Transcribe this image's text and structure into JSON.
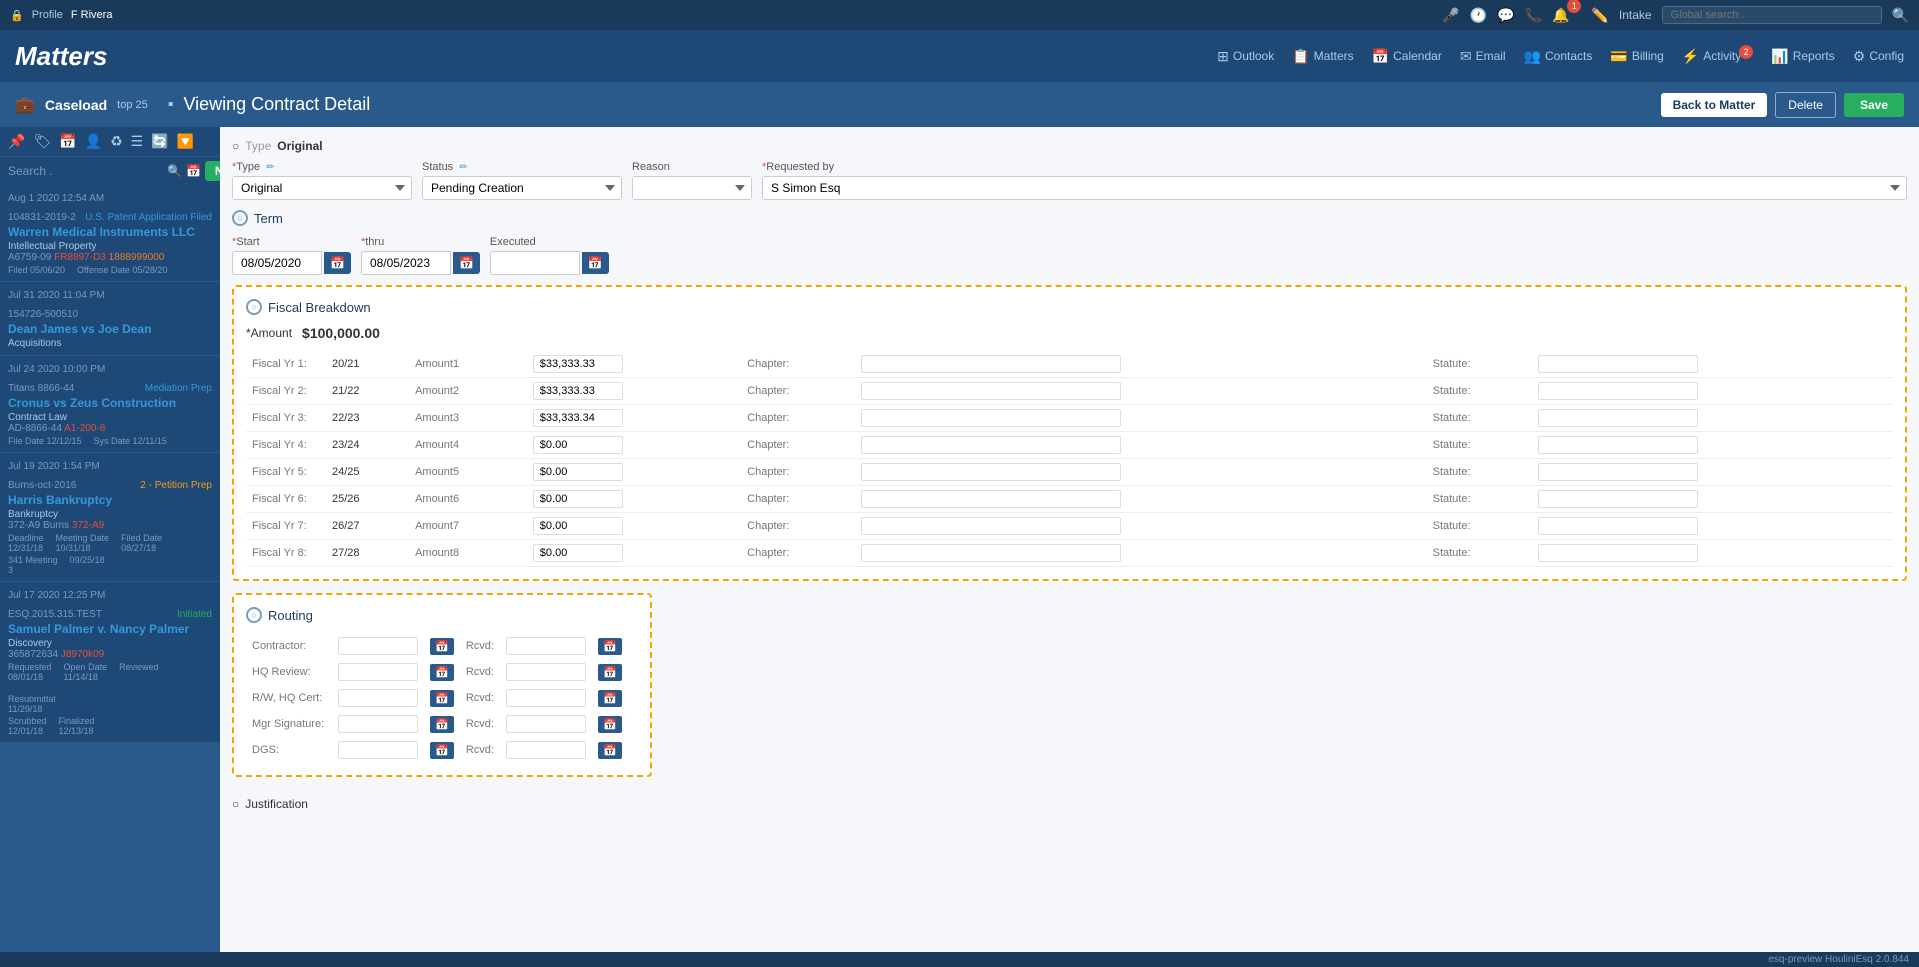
{
  "app": {
    "title": "Matters",
    "user": "F Rivera",
    "profile_label": "Profile"
  },
  "topnav": {
    "global_search_placeholder": "Global search .",
    "icons": [
      "microphone",
      "clock",
      "chat",
      "phone",
      "notification",
      "intake"
    ],
    "intake_label": "Intake",
    "notification_count": "1"
  },
  "appnav": {
    "items": [
      {
        "icon": "⊞",
        "label": "Outlook"
      },
      {
        "icon": "📋",
        "label": "Matters"
      },
      {
        "icon": "📅",
        "label": "Calendar"
      },
      {
        "icon": "✉",
        "label": "Email"
      },
      {
        "icon": "👥",
        "label": "Contacts"
      },
      {
        "icon": "💳",
        "label": "Billing"
      },
      {
        "icon": "⚡",
        "label": "Activity",
        "badge": "2"
      },
      {
        "icon": "📊",
        "label": "Reports"
      },
      {
        "icon": "⚙",
        "label": "Config"
      }
    ]
  },
  "content_header": {
    "caseload_label": "Caseload",
    "top_label": "top 25",
    "title": "Viewing Contract Detail",
    "back_button": "Back to Matter",
    "delete_button": "Delete",
    "save_button": "Save"
  },
  "sidebar": {
    "search_placeholder": "Search .",
    "new_button": "New",
    "items": [
      {
        "date_group": "Aug 1 2020 12:54 AM",
        "id": "104831-2019-2",
        "tag": "U.S. Patent Application Filed",
        "name": "Warren Medical Instruments LLC",
        "type": "Intellectual Property",
        "id2": "A6759-09",
        "id3": "FR8897-D3",
        "id4": "1888999000",
        "filed": "Filed 05/06/20",
        "offense": "Offense Date 05/28/20"
      },
      {
        "date_group": "Jul 31 2020 11:04 PM",
        "id": "154726-500510",
        "tag": "",
        "name": "Dean James vs Joe Dean",
        "type": "Acquisitions"
      },
      {
        "date_group": "Jul 24 2020 10:00 PM",
        "id": "Titans 8866-44",
        "tag": "Mediation Prep",
        "name": "Cronus vs Zeus Construction",
        "type": "Contract Law",
        "id2": "AD-8866-44",
        "id3": "A1-200-8",
        "filed": "File Date 12/12/15",
        "sys": "Sys Date 12/11/15"
      },
      {
        "date_group": "Jul 19 2020 1:54 PM",
        "id": "Burns-oct-2016",
        "tag": "2 - Petition Prep",
        "name": "Harris Bankruptcy",
        "type": "Bankruptcy",
        "id2": "372-A9 Burns",
        "id3": "372-A9",
        "dates": {
          "deadline": "12/31/18",
          "meeting_date": "10/31/18",
          "filed_date": "08/27/18",
          "meetings_341": "341 Meeting",
          "meetings_count": "3",
          "deadline2": "09/25/18"
        }
      },
      {
        "date_group": "Jul 17 2020 12:25 PM",
        "id": "ESQ.2015.315.TEST",
        "tag": "Initiated",
        "name": "Samuel Palmer v. Nancy Palmer",
        "type": "Discovery",
        "id2": "365872634",
        "id3": "J8970k09",
        "dates2": {
          "requested": "08/01/18",
          "open_date": "11/14/18",
          "reviewed": "",
          "resubmittal": "11/29/18",
          "scrubbed": "12/01/18",
          "finalized": "12/13/18"
        }
      }
    ]
  },
  "form": {
    "type_display_label": "Type",
    "type_display_value": "Original",
    "type_label": "Type",
    "type_value": "Original",
    "status_label": "Status",
    "status_value": "Pending Creation",
    "reason_label": "Reason",
    "reason_value": "",
    "requested_by_label": "Requested by",
    "requested_by_value": "S Simon Esq",
    "term_label": "Term",
    "start_label": "Start",
    "start_value": "08/05/2020",
    "thru_label": "thru",
    "thru_value": "08/05/2023",
    "executed_label": "Executed",
    "executed_value": ""
  },
  "fiscal": {
    "section_label": "Fiscal Breakdown",
    "amount_label": "Amount",
    "amount_value": "$100,000.00",
    "rows": [
      {
        "fy": "Fiscal Yr 1:",
        "range": "20/21",
        "amount_label": "Amount1",
        "amount": "$33,333.33",
        "chapter_label": "Chapter:",
        "chapter": "",
        "statute_label": "Statute:",
        "statute": ""
      },
      {
        "fy": "Fiscal Yr 2:",
        "range": "21/22",
        "amount_label": "Amount2",
        "amount": "$33,333.33",
        "chapter_label": "Chapter:",
        "chapter": "",
        "statute_label": "Statute:",
        "statute": ""
      },
      {
        "fy": "Fiscal Yr 3:",
        "range": "22/23",
        "amount_label": "Amount3",
        "amount": "$33,333.34",
        "chapter_label": "Chapter:",
        "chapter": "",
        "statute_label": "Statute:",
        "statute": ""
      },
      {
        "fy": "Fiscal Yr 4:",
        "range": "23/24",
        "amount_label": "Amount4",
        "amount": "$0.00",
        "chapter_label": "Chapter:",
        "chapter": "",
        "statute_label": "Statute:",
        "statute": ""
      },
      {
        "fy": "Fiscal Yr 5:",
        "range": "24/25",
        "amount_label": "Amount5",
        "amount": "$0.00",
        "chapter_label": "Chapter:",
        "chapter": "",
        "statute_label": "Statute:",
        "statute": ""
      },
      {
        "fy": "Fiscal Yr 6:",
        "range": "25/26",
        "amount_label": "Amount6",
        "amount": "$0.00",
        "chapter_label": "Chapter:",
        "chapter": "",
        "statute_label": "Statute:",
        "statute": ""
      },
      {
        "fy": "Fiscal Yr 7:",
        "range": "26/27",
        "amount_label": "Amount7",
        "amount": "$0.00",
        "chapter_label": "Chapter:",
        "chapter": "",
        "statute_label": "Statute:",
        "statute": ""
      },
      {
        "fy": "Fiscal Yr 8:",
        "range": "27/28",
        "amount_label": "Amount8",
        "amount": "$0.00",
        "chapter_label": "Chapter:",
        "chapter": "",
        "statute_label": "Statute:",
        "statute": ""
      }
    ]
  },
  "routing": {
    "section_label": "Routing",
    "rows": [
      {
        "label": "Contractor:",
        "rcvd_label": "Rcvd:"
      },
      {
        "label": "HQ Review:",
        "rcvd_label": "Rcvd:"
      },
      {
        "label": "R/W, HQ Cert:",
        "rcvd_label": "Rcvd:"
      },
      {
        "label": "Mgr Signature:",
        "rcvd_label": "Rcvd:"
      },
      {
        "label": "DGS:",
        "rcvd_label": "Rcvd:"
      }
    ]
  },
  "justification": {
    "section_label": "Justification"
  },
  "footer": {
    "text": "esq-preview  HouliniEsq 2.0.844"
  }
}
